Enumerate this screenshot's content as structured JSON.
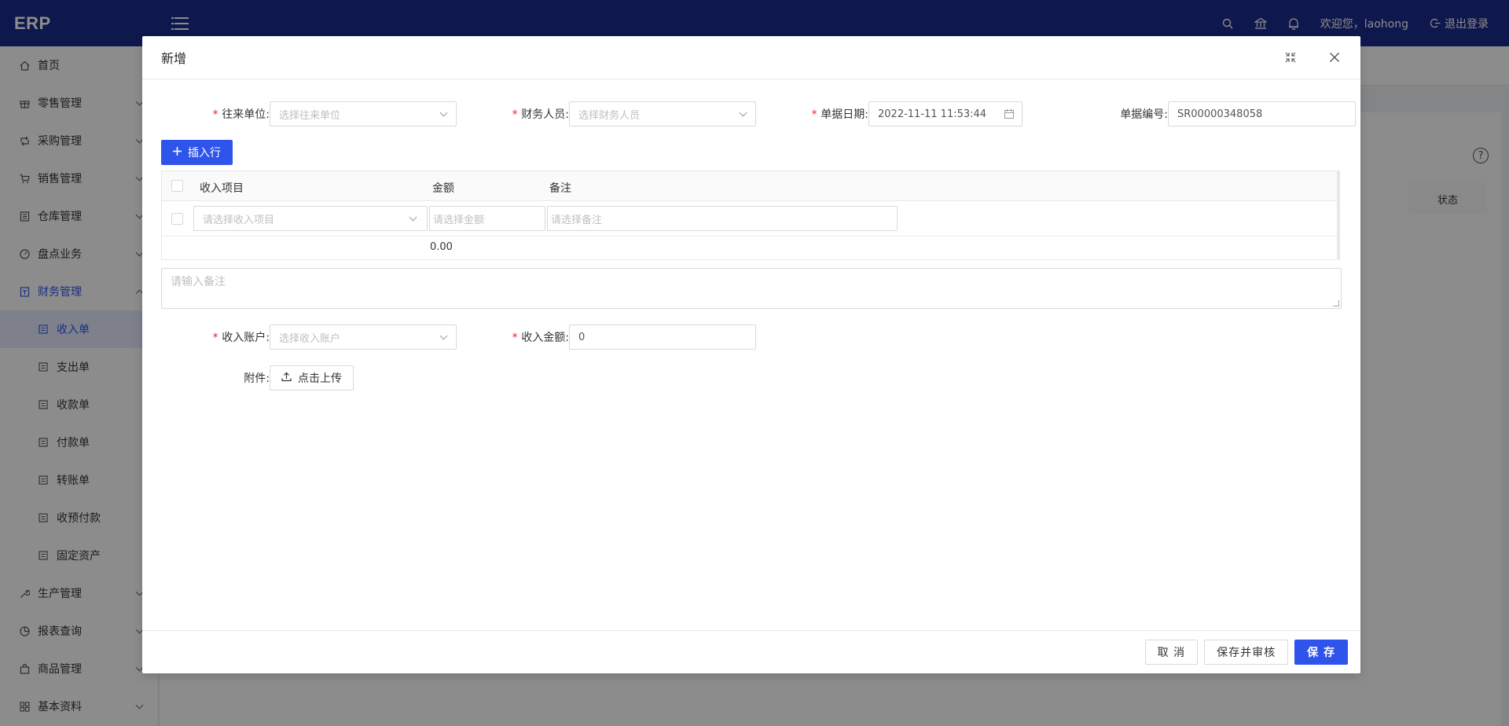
{
  "header": {
    "logo": "ERP",
    "welcome": "欢迎您，laohong",
    "logout": "退出登录"
  },
  "sidebar": {
    "items": [
      {
        "label": "首页",
        "icon": "home-icon"
      },
      {
        "label": "零售管理",
        "icon": "gift-icon"
      },
      {
        "label": "采购管理",
        "icon": "retweet-icon"
      },
      {
        "label": "销售管理",
        "icon": "cart-icon"
      },
      {
        "label": "仓库管理",
        "icon": "warehouse-icon"
      },
      {
        "label": "盘点业务",
        "icon": "dashboard-icon"
      },
      {
        "label": "财务管理",
        "icon": "finance-icon"
      }
    ],
    "finance_subitems": [
      {
        "label": "收入单"
      },
      {
        "label": "支出单"
      },
      {
        "label": "收款单"
      },
      {
        "label": "付款单"
      },
      {
        "label": "转账单"
      },
      {
        "label": "收预付款"
      },
      {
        "label": "固定资产"
      }
    ],
    "bottom_items": [
      {
        "label": "生产管理",
        "icon": "tool-icon"
      },
      {
        "label": "报表查询",
        "icon": "pie-chart-icon"
      },
      {
        "label": "商品管理",
        "icon": "shopping-icon"
      },
      {
        "label": "基本资料",
        "icon": "appstore-icon"
      }
    ]
  },
  "background": {
    "status_header": "状态"
  },
  "modal": {
    "title": "新增",
    "fields": {
      "partner_label": "往来单位:",
      "partner_placeholder": "选择往来单位",
      "staff_label": "财务人员:",
      "staff_placeholder": "选择财务人员",
      "date_label": "单据日期:",
      "date_value": "2022-11-11 11:53:44",
      "number_label": "单据编号:",
      "number_value": "SR00000348058"
    },
    "insert_row_button": "插入行",
    "table": {
      "columns": [
        "收入项目",
        "金额",
        "备注"
      ],
      "row_placeholders": {
        "item": "请选择收入项目",
        "amount": "请选择金额",
        "remark": "请选择备注"
      },
      "total": "0.00"
    },
    "remark_placeholder": "请输入备注",
    "account_label": "收入账户:",
    "account_placeholder": "选择收入账户",
    "amount_label": "收入金额:",
    "amount_value": "0",
    "attachment_label": "附件:",
    "upload_button": "点击上传",
    "footer": {
      "cancel": "取 消",
      "save_and_audit": "保存并审核",
      "save": "保 存"
    }
  }
}
